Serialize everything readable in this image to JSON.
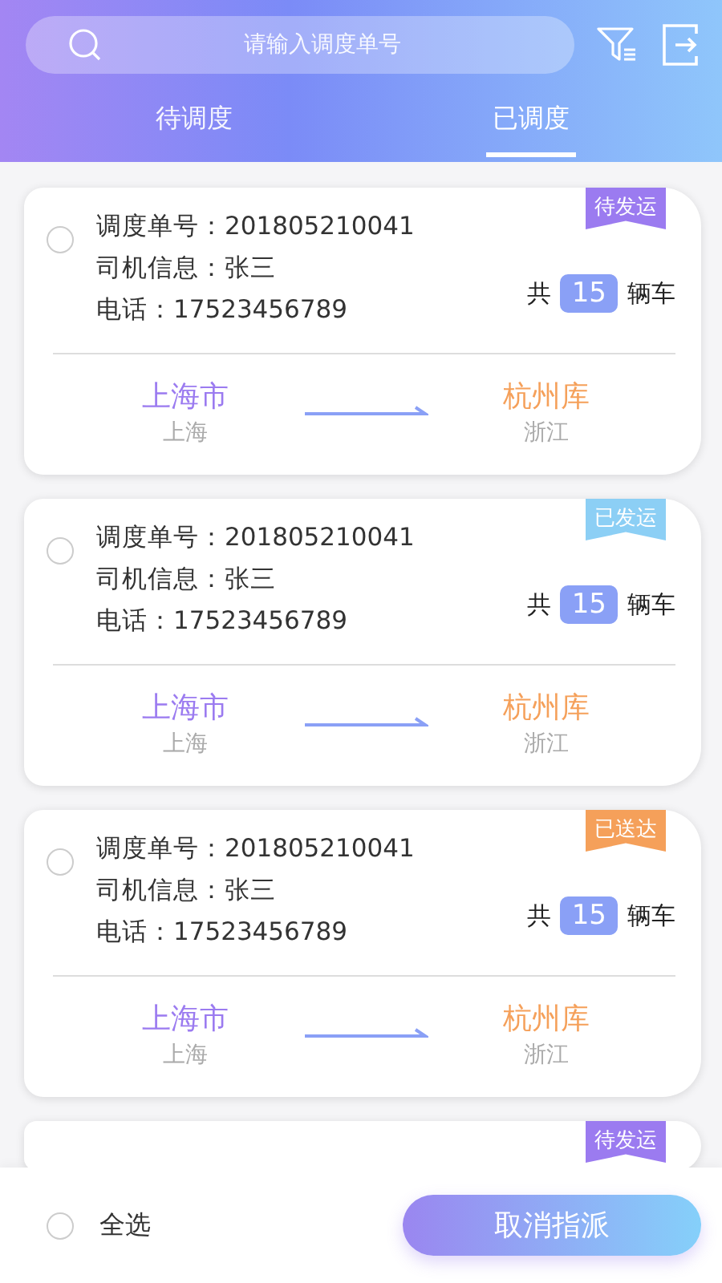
{
  "search": {
    "placeholder": "请输入调度单号"
  },
  "tabs": [
    {
      "label": "待调度",
      "selected": false
    },
    {
      "label": "已调度",
      "selected": true
    }
  ],
  "orders": [
    {
      "checked": false,
      "status": {
        "label": "待发运",
        "color": "#9b7bf0"
      },
      "order_no": "调度单号：201805210041",
      "driver": "司机信息：张三",
      "phone": "电话：17523456789",
      "count_prefix": "共",
      "count": "15",
      "count_suffix": "辆车",
      "origin": {
        "city": "上海市",
        "province": "上海"
      },
      "destination": {
        "city": "杭州库",
        "province": "浙江"
      }
    },
    {
      "checked": false,
      "status": {
        "label": "已发运",
        "color": "#8ccff5"
      },
      "order_no": "调度单号：201805210041",
      "driver": "司机信息：张三",
      "phone": "电话：17523456789",
      "count_prefix": "共",
      "count": "15",
      "count_suffix": "辆车",
      "origin": {
        "city": "上海市",
        "province": "上海"
      },
      "destination": {
        "city": "杭州库",
        "province": "浙江"
      }
    },
    {
      "checked": false,
      "status": {
        "label": "已送达",
        "color": "#f5a05a"
      },
      "order_no": "调度单号：201805210041",
      "driver": "司机信息：张三",
      "phone": "电话：17523456789",
      "count_prefix": "共",
      "count": "15",
      "count_suffix": "辆车",
      "origin": {
        "city": "上海市",
        "province": "上海"
      },
      "destination": {
        "city": "杭州库",
        "province": "浙江"
      }
    },
    {
      "status": {
        "label": "待发运",
        "color": "#9b7bf0"
      }
    }
  ],
  "footer": {
    "select_all": {
      "label": "全选",
      "checked": false
    },
    "action": "取消指派"
  }
}
